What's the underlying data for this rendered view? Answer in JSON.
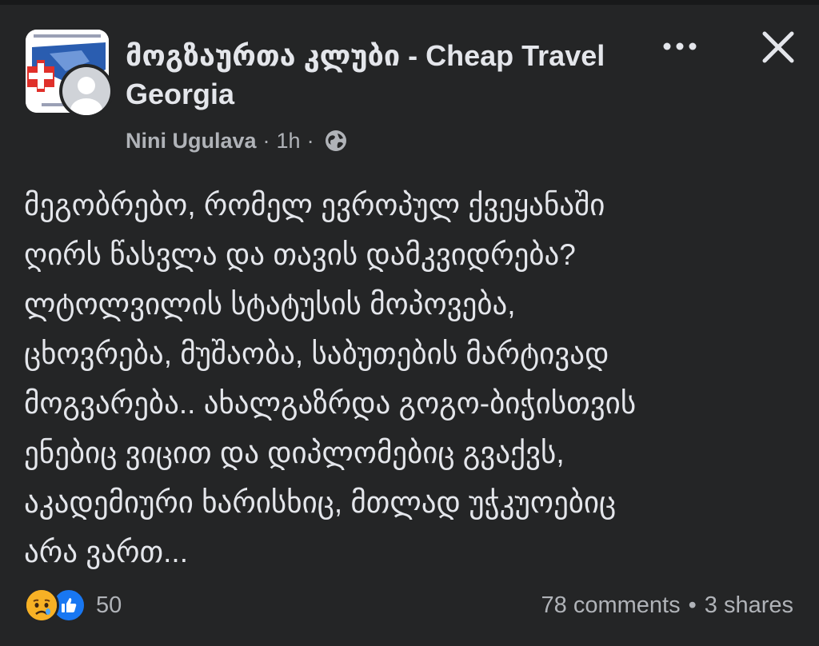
{
  "post": {
    "group_name": "მოგზაურთა კლუბი - Cheap Travel Georgia",
    "author": "Nini Ugulava",
    "separator": "·",
    "time": "1h",
    "visibility_icon": "globe-icon",
    "text_lines": [
      "მეგობრებო, რომელ ევროპულ ქვეყანაში",
      "ღირს წასვლა და თავის დამკვიდრება?",
      "ლტოლვილის სტატუსის მოპოვება,",
      "ცხოვრება, მუშაობა, საბუთების მარტივად",
      "მოგვარება.. ახალგაზრდა გოგო-ბიჭისთვის",
      "ენებიც ვიცით და დიპლომებიც გვაქვს,",
      "აკადემიური ხარისხიც, მთლად უჭკუოებიც",
      "არა ვართ..."
    ]
  },
  "reactions": {
    "icons": [
      "sad-reaction-icon",
      "like-reaction-icon"
    ],
    "count": "50"
  },
  "engagement": {
    "comments": "78 comments",
    "separator": "•",
    "shares": "3 shares"
  },
  "colors": {
    "background": "#242526",
    "text_primary": "#e4e6eb",
    "text_secondary": "#b0b3b8",
    "like_blue": "#1877f2",
    "sad_yellow": "#f7b125"
  }
}
